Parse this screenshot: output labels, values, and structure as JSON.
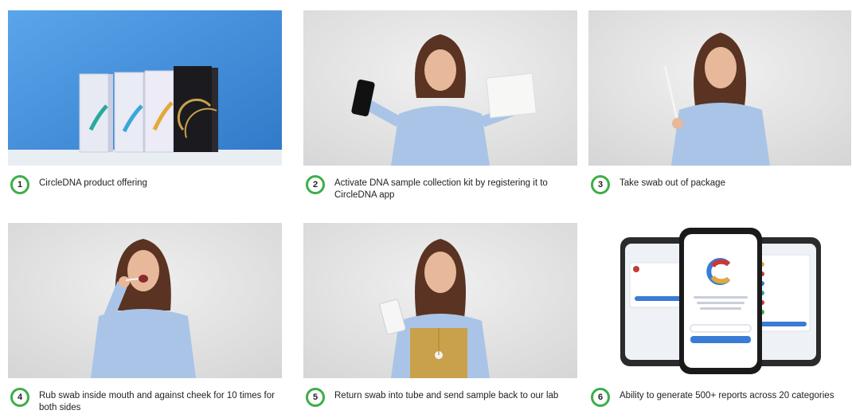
{
  "steps": [
    {
      "number": "1",
      "caption": "CircleDNA product offering"
    },
    {
      "number": "2",
      "caption": "Activate DNA sample collection kit by registering it to CircleDNA app"
    },
    {
      "number": "3",
      "caption": "Take swab out of package"
    },
    {
      "number": "4",
      "caption": "Rub swab inside mouth and against cheek for 10 times for both sides"
    },
    {
      "number": "5",
      "caption": "Return swab into tube and send sample back to our lab"
    },
    {
      "number": "6",
      "caption": "Ability to generate 500+ reports across 20 categories"
    }
  ],
  "colors": {
    "badge_ring": "#3dae49",
    "product_bg": "#3d8ad9",
    "studio_bg": "#e4e4e4",
    "shirt": "#a9c4e6",
    "hair": "#5a3322"
  }
}
